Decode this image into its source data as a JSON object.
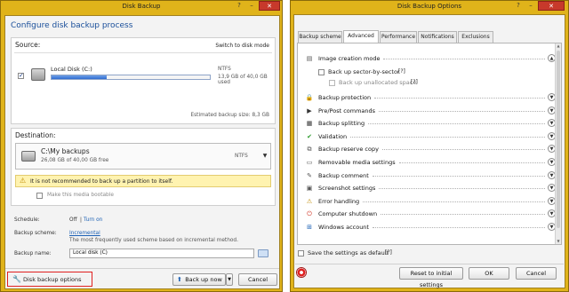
{
  "left_window": {
    "title": "Disk Backup",
    "heading": "Configure disk backup process",
    "source": {
      "label": "Source:",
      "switch_link": "Switch to disk mode",
      "disk_name": "Local Disk (C:)",
      "fs": "NTFS",
      "usage": "13,9 GB of 40,0 GB used",
      "usage_fraction": 0.35,
      "estimated": "Estimated backup size: 8,3 GB"
    },
    "destination": {
      "label": "Destination:",
      "path": "C:\\My backups",
      "free": "26,08 GB of 40,00 GB free",
      "fs": "NTFS",
      "warning": "It is not recommended to back up a partition to itself.",
      "bootable": "Make this media bootable"
    },
    "schedule": {
      "label": "Schedule:",
      "value": "Off",
      "sep": "|",
      "link": "Turn on"
    },
    "scheme": {
      "label": "Backup scheme:",
      "link": "Incremental",
      "desc": "The most frequently used scheme based on incremental method."
    },
    "name": {
      "label": "Backup name:",
      "value": "Local disk (C)"
    },
    "options_link": "Disk backup options",
    "backup_now": "Back up now",
    "cancel": "Cancel"
  },
  "right_window": {
    "title": "Disk Backup Options",
    "tabs": [
      "Backup scheme",
      "Advanced",
      "Performance",
      "Notifications",
      "Exclusions"
    ],
    "active_tab": 1,
    "image_mode": {
      "label": "Image creation mode",
      "sector": "Back up sector-by-sector",
      "unallocated": "Back up unallocated space",
      "help": "[?]"
    },
    "options": [
      {
        "label": "Backup protection",
        "icon": "🔒"
      },
      {
        "label": "Pre/Post commands",
        "icon": "▶"
      },
      {
        "label": "Backup splitting",
        "icon": "▦"
      },
      {
        "label": "Validation",
        "icon": "✔"
      },
      {
        "label": "Backup reserve copy",
        "icon": "⧉"
      },
      {
        "label": "Removable media settings",
        "icon": "▭"
      },
      {
        "label": "Backup comment",
        "icon": "✎"
      },
      {
        "label": "Screenshot settings",
        "icon": "▣"
      },
      {
        "label": "Error handling",
        "icon": "⚠"
      },
      {
        "label": "Computer shutdown",
        "icon": "⏻"
      },
      {
        "label": "Windows account",
        "icon": "⊞"
      }
    ],
    "save_default": "Save the settings as default",
    "help": "[?]",
    "reset": "Reset to initial settings",
    "ok": "OK",
    "cancel": "Cancel"
  },
  "colors": {
    "frame": "#e0b31a",
    "link": "#1a5fb4",
    "warning_bg": "#fff3b0",
    "close": "#c7392b"
  }
}
